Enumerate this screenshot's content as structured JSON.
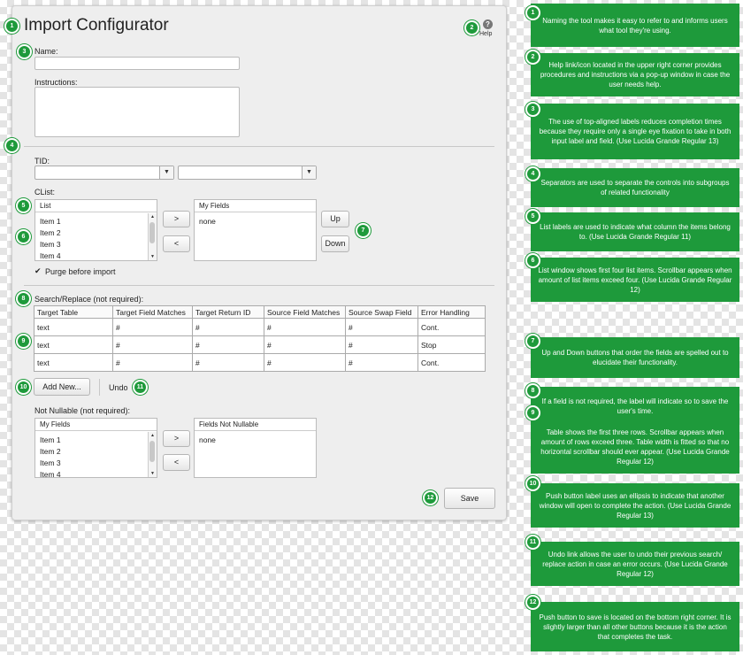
{
  "form": {
    "title": "Import Configurator",
    "help_label": "Help",
    "help_glyph": "?",
    "name_label": "Name:",
    "instructions_label": "Instructions:",
    "tid_label": "TID:",
    "clist_label": "CList:",
    "list_header": "List",
    "list_items": [
      "Item 1",
      "Item 2",
      "Item 3",
      "Item 4"
    ],
    "myfields_header": "My Fields",
    "myfields_value": "none",
    "move_right": ">",
    "move_left": "<",
    "up_label": "Up",
    "down_label": "Down",
    "purge_check": "✔",
    "purge_label": "Purge before import",
    "search_label": "Search/Replace (not required):",
    "table_headers": [
      "Target Table",
      "Target Field Matches",
      "Target Return ID",
      "Source Field Matches",
      "Source Swap Field",
      "Error Handling"
    ],
    "table_rows": [
      [
        "text",
        "#",
        "#",
        "#",
        "#",
        "Cont."
      ],
      [
        "text",
        "#",
        "#",
        "#",
        "#",
        "Stop"
      ],
      [
        "text",
        "#",
        "#",
        "#",
        "#",
        "Cont."
      ]
    ],
    "add_new_label": "Add New...",
    "undo_label": "Undo",
    "notnull_label": "Not Nullable (not required):",
    "nn_myfields_header": "My Fields",
    "nn_items": [
      "Item 1",
      "Item 2",
      "Item 3",
      "Item 4"
    ],
    "fields_not_nullable_header": "Fields Not Nullable",
    "fields_not_nullable_value": "none",
    "save_label": "Save"
  },
  "markers": [
    "1",
    "2",
    "3",
    "4",
    "5",
    "6",
    "7",
    "8",
    "9",
    "10",
    "11",
    "12"
  ],
  "notes": [
    {
      "num": "1",
      "text": "Naming the tool makes it easy to refer to and informs users what tool they're using."
    },
    {
      "num": "2",
      "text": "Help link/icon located in the upper right corner provides procedures and instructions via a pop-up window in case the user needs help."
    },
    {
      "num": "3",
      "text": "The use of top-aligned labels reduces completion times because they require only a single eye fixation to take in both input label and field. (Use Lucida Grande Regular 13)"
    },
    {
      "num": "4",
      "text": "Separators are used to separate the controls into subgroups of related functionality"
    },
    {
      "num": "5",
      "text": "List labels are used to indicate what column the items belong to. (Use Lucida Grande Regular 11)"
    },
    {
      "num": "6",
      "text": "List window shows first four list items. Scrollbar appears when amount of list items exceed four. (Use Lucida Grande Regular 12)"
    },
    {
      "num": "7",
      "text": "Up and Down buttons that order the fields are spelled out to elucidate their functionality."
    },
    {
      "num": "8",
      "text": "If a field is not required, the label will indicate so to save the user's time."
    },
    {
      "num": "9",
      "text": "Table shows the first three rows. Scrollbar appears when amount of rows exceed three. Table width is fitted so that no horizontal scrollbar should ever appear. (Use Lucida Grande Regular 12)"
    },
    {
      "num": "10",
      "text": "Push button label uses an ellipsis to indicate that another window will open to complete the action. (Use Lucida Grande Regular 13)"
    },
    {
      "num": "11",
      "text": "Undo link allows the user to undo their previous search/ replace action in case an error occurs. (Use Lucida Grande Regular 12)"
    },
    {
      "num": "12",
      "text": "Push button to save is located on the bottom right corner. It is slightly larger than all other buttons because it is the action that completes the task."
    }
  ],
  "colors": {
    "accent": "#1e9a3b",
    "panel": "#eeeeee"
  }
}
